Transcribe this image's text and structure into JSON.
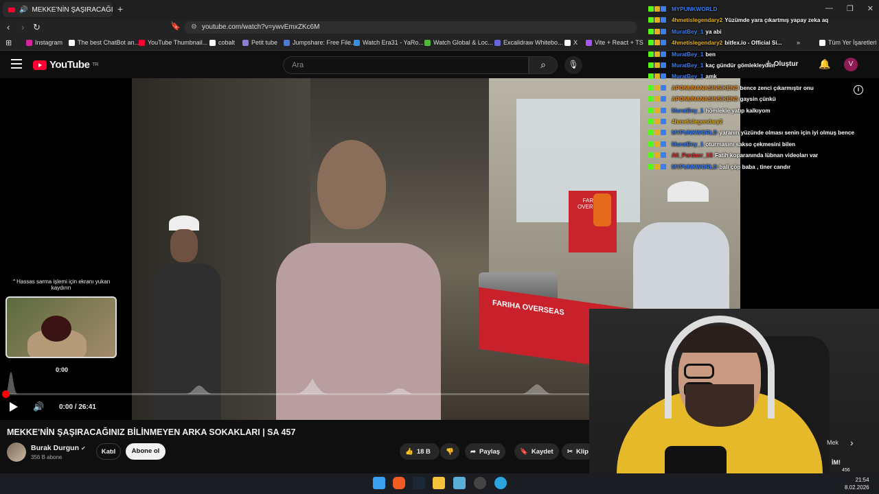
{
  "browser": {
    "tab_title": "MEKKE'NİN ŞAŞIRACAĞINIZ B",
    "tab_close": "×",
    "new_tab": "+",
    "url": "youtube.com/watch?v=ywvEmxZKc6M",
    "window_controls": [
      "—",
      "❐",
      "✕"
    ],
    "bookmarks": [
      {
        "label": "Instagram",
        "color": "#d6249f"
      },
      {
        "label": "The best ChatBot an...",
        "color": "#ffffff"
      },
      {
        "label": "YouTube Thumbnail...",
        "color": "#ff0033"
      },
      {
        "label": "cobalt",
        "color": "#ffffff"
      },
      {
        "label": "Petit tube",
        "color": "#8f7bd8"
      },
      {
        "label": "Jumpshare: Free File...",
        "color": "#4a7bd8"
      },
      {
        "label": "Watch Era31 - YaRo...",
        "color": "#3a8de0"
      },
      {
        "label": "Watch Global & Loc...",
        "color": "#53b83a"
      },
      {
        "label": "Excalidraw Whitebo...",
        "color": "#6965db"
      },
      {
        "label": "X",
        "color": "#ffffff"
      },
      {
        "label": "Vite + React + TS",
        "color": "#a855f7"
      },
      {
        "label": "Tüm Yer İşaretleri",
        "color": "#ffffff"
      }
    ],
    "bookmarks_more": "»"
  },
  "youtube": {
    "logo_text": "YouTube",
    "logo_region": "TR",
    "search_placeholder": "Ara",
    "create_label": "Oluştur",
    "avatar_letter": "V"
  },
  "player": {
    "scrub_hint": "Hassas sarma işlemi için ekranı yukarı kaydırın",
    "preview_time": "0:00",
    "time_display": "0:00 / 26:41",
    "progress_fraction": 0.0,
    "info_icon": "i"
  },
  "chat": [
    {
      "user": "MYPUNKWORLD",
      "color": "#3f7de8",
      "text": ""
    },
    {
      "user": "4hmetislegendary2",
      "color": "#e0b020",
      "text": "Yüzümde yara çıkartmış yapay zeka aq"
    },
    {
      "user": "MuratBey_1",
      "color": "#3f7de8",
      "text": "ya abi"
    },
    {
      "user": "4hmetislegendary2",
      "color": "#e0b020",
      "text": "bitfex.io - Official Si..."
    },
    {
      "user": "MuratBey_1",
      "color": "#3f7de8",
      "text": "ben"
    },
    {
      "user": "MuratBey_1",
      "color": "#3f7de8",
      "text": "kaç gündür gömlekleydim"
    },
    {
      "user": "MuratBey_1",
      "color": "#3f7de8",
      "text": "amk"
    },
    {
      "user": "APONUNANASINSIKEN3",
      "color": "#e08a20",
      "text": "bence zenci çıkarmıştır onu"
    },
    {
      "user": "APONUNANASINSIKEN3",
      "color": "#e08a20",
      "text": "gaysin çünkü"
    },
    {
      "user": "MuratBey_1",
      "color": "#3f7de8",
      "text": "hömlekle yatıp kalkıyom"
    },
    {
      "user": "4hmetislegendary2",
      "color": "#e0b020",
      "text": ""
    },
    {
      "user": "MYPUNKWORLD",
      "color": "#3f7de8",
      "text": "yaranın yüzünde olması senin için iyi olmuş bence"
    },
    {
      "user": "MuratBey_1",
      "color": "#3f7de8",
      "text": "oturmasını sakso çekmesini bilen"
    },
    {
      "user": "Ali_Pardasr_1S",
      "color": "#e03030",
      "text": "Fatih koparanında lübnan videoları var"
    },
    {
      "user": "MYPUNKWORLD",
      "color": "#3f7de8",
      "text": "bali çöp baba , tiner candır"
    }
  ],
  "scene": {
    "shop_sign": "FARIHA OVERSEAS",
    "cart_text": "FARIHA OVERSEAS"
  },
  "video": {
    "title": "MEKKE'NİN ŞAŞIRACAĞINIZ BİLİNMEYEN ARKA SOKAKLARI | SA 457",
    "channel": "Burak Durgun",
    "verified": "✔",
    "subscribers": "356 B abone",
    "join_label": "Katıl",
    "subscribe_label": "Abone ol",
    "likes": "18 B",
    "share_label": "Paylaş",
    "save_label": "Kaydet",
    "clip_label": "Klip"
  },
  "side": {
    "label": "Mek",
    "label2": "İM!",
    "num": "456"
  },
  "taskbar": {
    "time": "21:54",
    "date": "8.02.2026"
  }
}
